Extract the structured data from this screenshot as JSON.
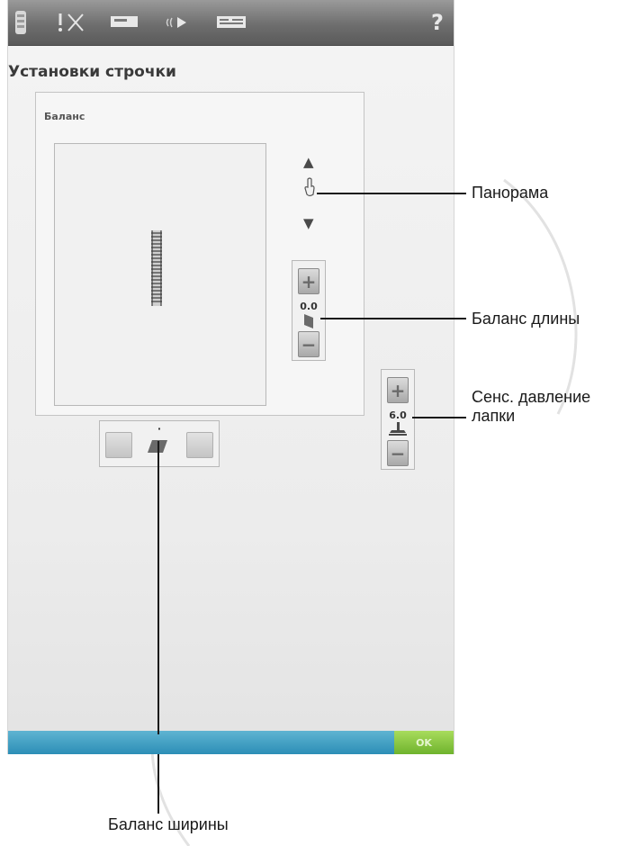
{
  "screen": {
    "title": "Установки строчки",
    "panel": {
      "label": "Баланс",
      "length_control": {
        "value": "0.0",
        "plus": "+",
        "minus": "−"
      },
      "width_control": {
        "value": "·"
      }
    },
    "presser_foot_control": {
      "value": "6.0",
      "plus": "+",
      "minus": "−"
    },
    "ok_label": "OK"
  },
  "topbar": {
    "help_label": "?",
    "icons": [
      "machine-icon",
      "stitch-icon",
      "presser-foot-icon",
      "sound-icon",
      "settings-icon",
      "help-icon"
    ]
  },
  "callouts": {
    "panorama": "Панорама",
    "length_balance": "Баланс длины",
    "presser_foot_line1": "Сенс. давление",
    "presser_foot_line2": "лапки",
    "width_balance": "Баланс ширины"
  },
  "colors": {
    "topbar": "#6e6e6e",
    "bottom_bar": "#2c8eb6",
    "ok_button": "#7fc23a"
  }
}
